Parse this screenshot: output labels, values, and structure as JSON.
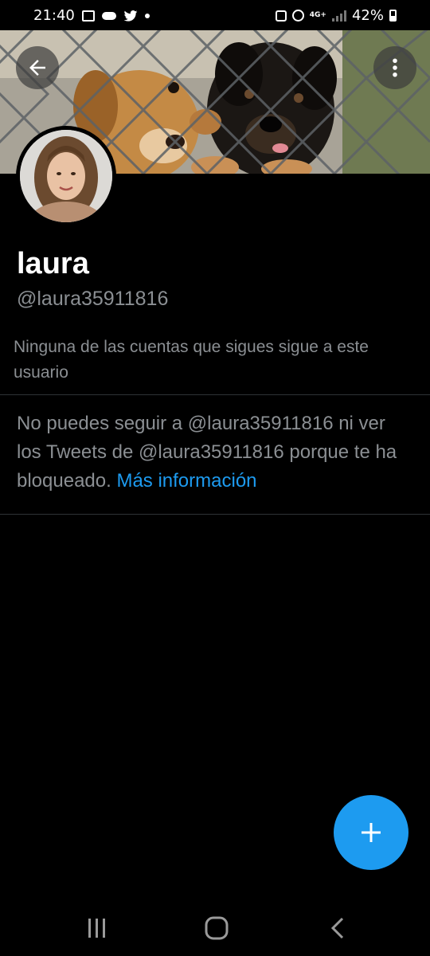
{
  "status_bar": {
    "time": "21:40",
    "battery": "42%",
    "network": "4G+"
  },
  "profile": {
    "name": "laura",
    "handle": "@laura35911816",
    "follow_note": "Ninguna de las cuentas que sigues sigue a este usuario"
  },
  "blocked": {
    "message": "No puedes seguir a @laura35911816 ni ver los Tweets de @laura35911816 porque te ha bloqueado.",
    "link": "Más información"
  },
  "icons": {
    "back": "arrow-left-icon",
    "more": "more-vertical-icon",
    "compose": "plus-icon",
    "nav_recent": "recent-apps-icon",
    "nav_home": "home-icon",
    "nav_back": "back-chevron-icon"
  },
  "colors": {
    "background": "#000000",
    "accent": "#1d9bf0",
    "secondary_text": "#8b8f93",
    "divider": "#2f3336"
  }
}
